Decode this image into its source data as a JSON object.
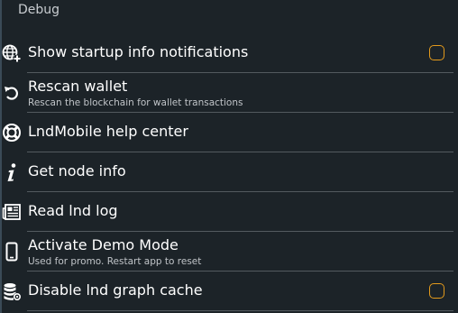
{
  "section": {
    "title": "Debug"
  },
  "colors": {
    "background": "#1c2328",
    "divider": "#535a5f",
    "checkbox_accent": "#e39a1c"
  },
  "items": [
    {
      "title": "Show startup info notifications",
      "icon": "globe-plus-icon",
      "checkbox": true,
      "checked": false
    },
    {
      "title": "Rescan wallet",
      "subtitle": "Rescan the blockchain for wallet transactions",
      "icon": "rotate-icon"
    },
    {
      "title": "LndMobile help center",
      "icon": "lifebuoy-icon"
    },
    {
      "title": "Get node info",
      "icon": "info-icon"
    },
    {
      "title": "Read lnd log",
      "icon": "newspaper-icon"
    },
    {
      "title": "Activate Demo Mode",
      "subtitle": "Used for promo. Restart app to reset",
      "icon": "mobile-phone-icon"
    },
    {
      "title": "Disable lnd graph cache",
      "icon": "database-settings-icon",
      "checkbox": true,
      "checked": false
    }
  ]
}
